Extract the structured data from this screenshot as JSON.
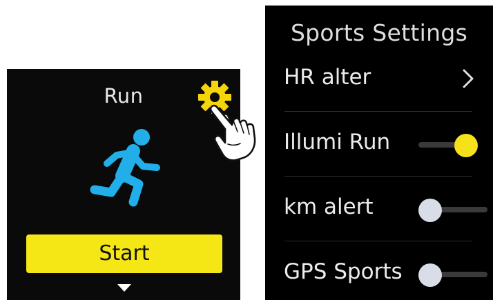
{
  "workout": {
    "title": "Run",
    "start_label": "Start"
  },
  "settings": {
    "title": "Sports Settings",
    "items": [
      {
        "label": "HR alter",
        "control": "chevron"
      },
      {
        "label": "Illumi Run",
        "control": "toggle",
        "enabled": true
      },
      {
        "label": "km alert",
        "control": "toggle",
        "enabled": false
      },
      {
        "label": "GPS Sports",
        "control": "toggle",
        "enabled": false
      }
    ]
  },
  "icons": {
    "settings": "gear-icon",
    "workout": "running-figure-icon",
    "more": "triangle-down-icon",
    "tap": "pointing-hand-icon",
    "navigate": "chevron-right-icon"
  },
  "colors": {
    "accent_yellow": "#f5e616",
    "run_icon_blue": "#22aee8",
    "screen_background": "#000000",
    "toggle_off_knob": "#d9dde8",
    "toggle_track": "#3a3a3a"
  }
}
